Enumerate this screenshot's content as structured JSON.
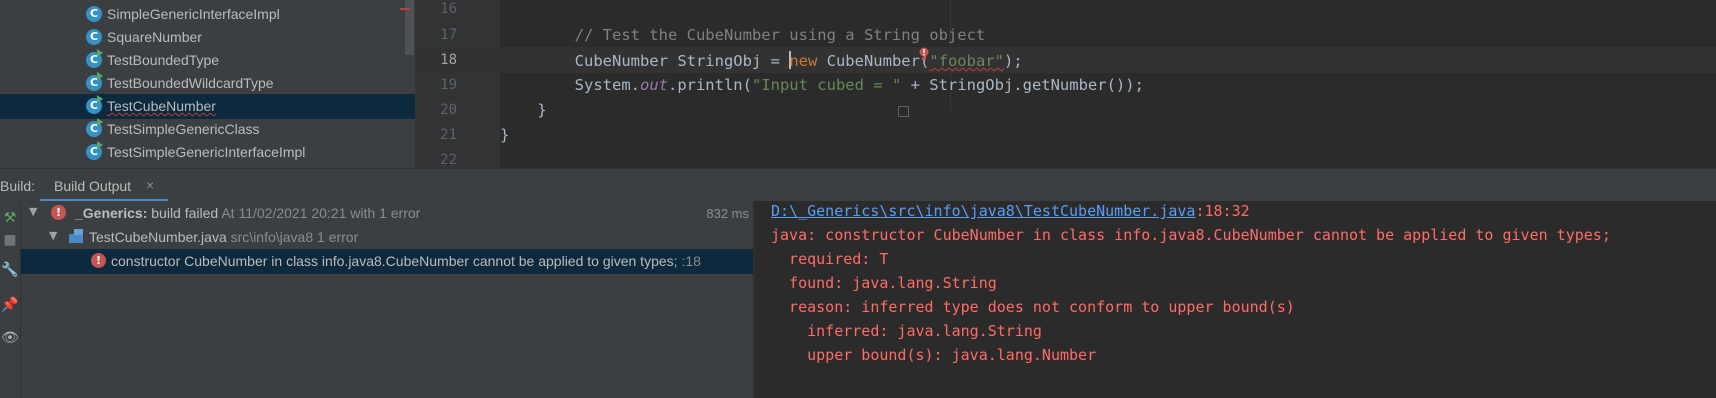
{
  "project_tree": {
    "items": [
      {
        "label": "SimpleGenericInterfaceImpl",
        "icon": "class-icon",
        "runnable": false,
        "selected": false,
        "squiggle": false
      },
      {
        "label": "SquareNumber",
        "icon": "class-icon",
        "runnable": false,
        "selected": false,
        "squiggle": false
      },
      {
        "label": "TestBoundedType",
        "icon": "runnable-class-icon",
        "runnable": true,
        "selected": false,
        "squiggle": false
      },
      {
        "label": "TestBoundedWildcardType",
        "icon": "runnable-class-icon",
        "runnable": true,
        "selected": false,
        "squiggle": false
      },
      {
        "label": "TestCubeNumber",
        "icon": "runnable-class-icon",
        "runnable": true,
        "selected": true,
        "squiggle": true
      },
      {
        "label": "TestSimpleGenericClass",
        "icon": "runnable-class-icon",
        "runnable": true,
        "selected": false,
        "squiggle": false
      },
      {
        "label": "TestSimpleGenericInterfaceImpl",
        "icon": "runnable-class-icon",
        "runnable": true,
        "selected": false,
        "squiggle": false
      }
    ]
  },
  "editor": {
    "current_line": "18",
    "lines": [
      {
        "num": "16"
      },
      {
        "num": "17",
        "comment": "// Test the CubeNumber using a String object"
      },
      {
        "num": "18",
        "type": "CubeNumber",
        "var": " StringObj = ",
        "kw": "new",
        "ctor": " CubeNumber(",
        "str": "\"foobar\"",
        "end": ");"
      },
      {
        "num": "19",
        "sys": "System.",
        "field": "out",
        "call": ".println(",
        "str": "\"Input cubed = \"",
        "rest": " + StringObj.getNumber());"
      },
      {
        "num": "20",
        "text": "}"
      },
      {
        "num": "21",
        "text": "}"
      },
      {
        "num": "22"
      }
    ]
  },
  "build_panel": {
    "prefix": "Build:",
    "tab_label": "Build Output",
    "close_glyph": "×",
    "root": {
      "name": "_Generics:",
      "status": "build failed",
      "detail": "At 11/02/2021 20:21 with 1 error",
      "duration": "832 ms"
    },
    "file": {
      "name": "TestCubeNumber.java",
      "path": "src\\info\\java8",
      "count": "1 error"
    },
    "error": {
      "message": "constructor CubeNumber in class info.java8.CubeNumber cannot be applied to given types;",
      "line": ":18"
    }
  },
  "console": {
    "link": "D:\\_Generics\\src\\info\\java8\\TestCubeNumber.java",
    "link_suffix": ":18:32",
    "lines": [
      "java: constructor CubeNumber in class info.java8.CubeNumber cannot be applied to given types;",
      "  required: T",
      "  found: java.lang.String",
      "  reason: inferred type does not conform to upper bound(s)",
      "    inferred: java.lang.String",
      "    upper bound(s): java.lang.Number"
    ]
  },
  "colors": {
    "selection": "#0d293e",
    "error": "#ff6b68",
    "link": "#589df6",
    "keyword": "#cc7832",
    "string": "#6a8759"
  }
}
